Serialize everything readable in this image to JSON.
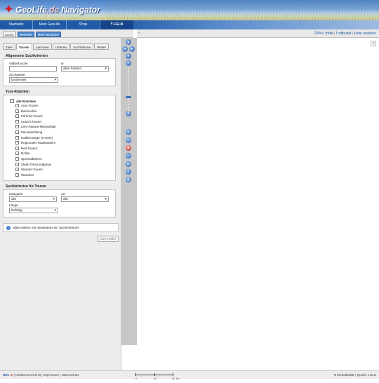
{
  "header": {
    "brand_part1": "GeoLife",
    "brand_part2": ".de",
    "brand_part3": " Navigator",
    "lgln": "LGLN"
  },
  "topnav": [
    "Startseite",
    "Mein GeoLife",
    "Shop"
  ],
  "mode_tabs": [
    "Suche",
    "Merkliste",
    "Mein Navigator"
  ],
  "map_links": [
    "ÖPNV",
    "Hilfe",
    "Treffpunkt",
    "Karte erstellen"
  ],
  "sub_tabs": [
    "Ziele",
    "Touren",
    "Adressen",
    "Umkreis",
    "Suchhistorie",
    "Wetter"
  ],
  "general_criteria": {
    "title": "Allgemeine Suchkriterien",
    "fulltext_label": "Volltextsuche",
    "fulltext_value": "",
    "in_label": "in",
    "in_value": "allen Feldern",
    "area_label": "Suchgebiet",
    "area_value": "landesweit"
  },
  "rubrics": {
    "title": "Tour-Rubriken",
    "all_label": "alle Rubriken",
    "items": [
      "Auto-Touren",
      "Barrierefrei",
      "Fahrrad-Touren",
      "Kutsch-Touren",
      "Lehr-/Naturerlebnispfade",
      "Mountainbiking",
      "Radfernwege (N-Netz)",
      "Regionales Radwandern",
      "Reit-Touren",
      "Rollen",
      "Sportradfahren",
      "Stadt-/Ortsrundgänge",
      "Wander-Touren",
      "Wandern"
    ]
  },
  "tour_criteria": {
    "title": "Suchkriterien für Touren",
    "category_label": "Kategorie",
    "category_value": "alle",
    "type_label": "Art",
    "type_value": "alle",
    "length_label": "Länge",
    "length_value": "beliebig"
  },
  "info_message": "Bitte wählen Sie mindestens ein Suchkriterium!",
  "hits_button": "zum Treffer",
  "map_tools": {
    "zoom_in": "+",
    "zoom_out": "−"
  },
  "footer": {
    "hol": "HOL",
    "links": [
      "Inhaltsverzeichnis",
      "Impressum",
      "Datenschutz"
    ],
    "scale_labels": [
      "0",
      "10",
      "20",
      "km"
    ],
    "credit": "WebatlasDE | Quelle: LGLN"
  },
  "colors": {
    "nav_blue": "#1e5aa6",
    "accent_red": "#d31f2c"
  }
}
